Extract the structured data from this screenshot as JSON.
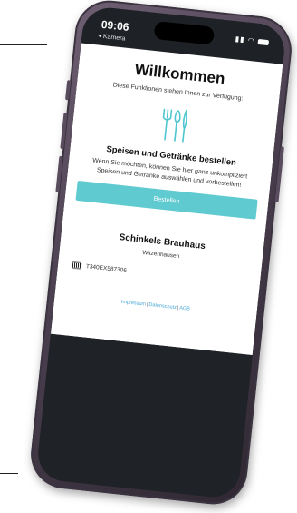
{
  "statusbar": {
    "time": "09:06",
    "back_label": "◂ Kamera"
  },
  "page": {
    "title": "Willkommen",
    "subtitle": "Diese Funktionen stehen Ihnen zur Verfügung:",
    "feature": {
      "icon": "cutlery-icon",
      "title": "Speisen und Getränke bestellen",
      "description": "Wenn Sie möchten, können Sie hier ganz unkompliziert Speisen und Getränke auswählen und vorbestellen!",
      "button_label": "Bestellen"
    },
    "restaurant": {
      "name": "Schinkels Brauhaus",
      "city": "Witzenhausen"
    },
    "table_code": "T340EX587306",
    "footer_links": [
      "Impressum",
      "Datenschutz",
      "AGB"
    ]
  },
  "colors": {
    "accent": "#5fcad0",
    "link": "#46a7d6"
  }
}
